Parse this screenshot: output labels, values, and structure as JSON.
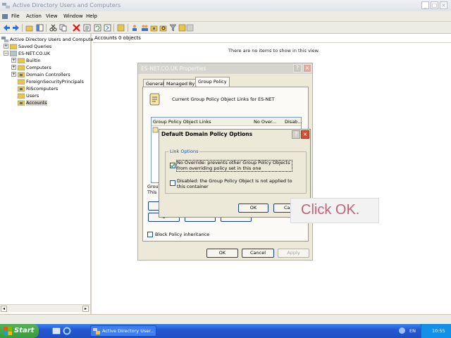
{
  "window": {
    "title": "Active Directory Users and Computers"
  },
  "menu": {
    "items": [
      "File",
      "Action",
      "View",
      "Window",
      "Help"
    ]
  },
  "tree": {
    "root": "Active Directory Users and Computers",
    "items": [
      "Saved Queries",
      "ES-NET.CO.UK",
      "Builtin",
      "Computers",
      "Domain Controllers",
      "ForeignSecurityPrincipals",
      "RIScomputers",
      "Users",
      "Accounts"
    ],
    "selected": "Accounts"
  },
  "list": {
    "header_name": "Accounts",
    "header_count": "0 objects",
    "empty_text": "There are no items to show in this view."
  },
  "props_dialog": {
    "title": "ES-NET.CO.UK Properties",
    "tabs": [
      "General",
      "Managed By",
      "Group Policy"
    ],
    "active_tab": "Group Policy",
    "gp_heading": "Current Group Policy Object Links for ES-NET",
    "col_links": "Group Policy Object Links",
    "col_override": "No Over...",
    "col_disabled": "Disab...",
    "frag_group": "Group",
    "frag_this": "This l",
    "frag_button": "O",
    "block_label": "Block Policy inheritance",
    "ok": "OK",
    "cancel": "Cancel",
    "apply": "Apply"
  },
  "options_dialog": {
    "title": "Default Domain Policy Options",
    "group_label": "Link Options",
    "no_override": "No Override:  prevents other Group Policy Objects from overriding policy set in this one",
    "no_override_checked": true,
    "disabled": "Disabled:  the Group Policy Object is not applied to this container",
    "disabled_checked": false,
    "ok": "OK",
    "cancel_partial": "Ca"
  },
  "callout": {
    "text": "Click OK."
  },
  "taskbar": {
    "start": "Start",
    "task": "Active Directory User...",
    "lang": "EN",
    "clock": "10:55"
  },
  "colors": {
    "accent": "#1f4e9c",
    "callout_text": "#c46078",
    "taskbar": "#2559d1",
    "start_green": "#3a9a3c"
  }
}
